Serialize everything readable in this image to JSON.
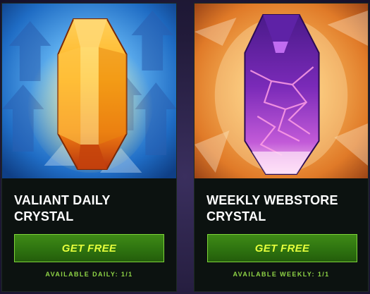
{
  "cards": [
    {
      "title": "VALIANT DAILY CRYSTAL",
      "button_label": "GET FREE",
      "availability": "AVAILABLE DAILY: 1/1",
      "icon": "amber-crystal-icon",
      "accent": "#f5a623",
      "background": "#2f7fd0"
    },
    {
      "title": "WEEKLY WEBSTORE CRYSTAL",
      "button_label": "GET FREE",
      "availability": "AVAILABLE WEEKLY: 1/1",
      "icon": "void-crystal-icon",
      "accent": "#9b3fd6",
      "background": "#e07a28"
    }
  ],
  "colors": {
    "button_bg": "#2e7310",
    "button_text": "#e6ff3c",
    "availability_text": "#8fd446",
    "card_bg": "#0c1210"
  }
}
